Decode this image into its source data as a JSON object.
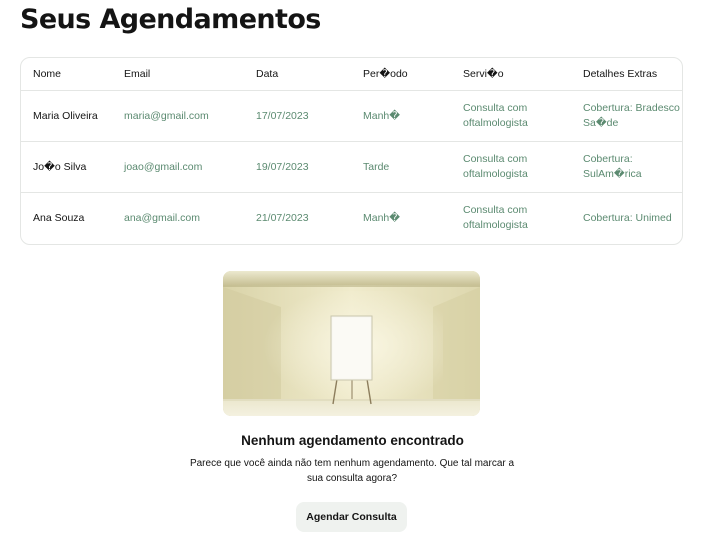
{
  "page": {
    "title": "Seus Agendamentos"
  },
  "table": {
    "headers": [
      "Nome",
      "Email",
      "Data",
      "Per�odo",
      "Servi�o",
      "Detalhes Extras"
    ],
    "rows": [
      {
        "nome": "Maria Oliveira",
        "email": "maria@gmail.com",
        "data": "17/07/2023",
        "periodo": "Manh�",
        "servico": "Consulta com oftalmologista",
        "detalhes": "Cobertura: Bradesco Sa�de"
      },
      {
        "nome": "Jo�o Silva",
        "email": "joao@gmail.com",
        "data": "19/07/2023",
        "periodo": "Tarde",
        "servico": "Consulta com oftalmologista",
        "detalhes": "Cobertura: SulAm�rica"
      },
      {
        "nome": "Ana Souza",
        "email": "ana@gmail.com",
        "data": "21/07/2023",
        "periodo": "Manh�",
        "servico": "Consulta com oftalmologista",
        "detalhes": "Cobertura: Unimed"
      }
    ]
  },
  "empty_state": {
    "title": "Nenhum agendamento encontrado",
    "description": "Parece que você ainda não tem nenhum agendamento. Que tal marcar a sua consulta agora?",
    "button_label": "Agendar Consulta",
    "illustration": "empty-room-easel-illustration"
  },
  "colors": {
    "text": "#141414",
    "accent": "#5b8a70",
    "border": "#e4e6e4",
    "button_bg": "#eff2ef"
  }
}
